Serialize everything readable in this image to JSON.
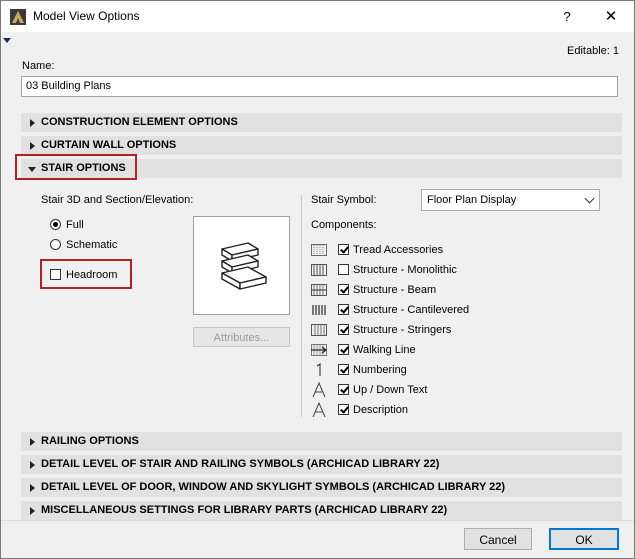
{
  "window": {
    "title": "Model View Options",
    "help_label": "?",
    "close_label": "✕",
    "editable_text": "Editable: 1"
  },
  "name_field": {
    "label": "Name:",
    "value": "03 Building Plans"
  },
  "sections": {
    "construction": "CONSTRUCTION ELEMENT OPTIONS",
    "curtain_wall": "CURTAIN WALL OPTIONS",
    "stair": "STAIR OPTIONS",
    "railing": "RAILING OPTIONS",
    "detail_stair": "DETAIL LEVEL OF STAIR AND RAILING SYMBOLS (ARCHICAD LIBRARY 22)",
    "detail_door": "DETAIL LEVEL OF DOOR, WINDOW AND SKYLIGHT SYMBOLS (ARCHICAD LIBRARY 22)",
    "misc": "MISCELLANEOUS SETTINGS FOR LIBRARY PARTS (ARCHICAD LIBRARY 22)"
  },
  "stair_3d": {
    "label": "Stair 3D and Section/Elevation:",
    "full": "Full",
    "full_selected": true,
    "schematic": "Schematic",
    "headroom": "Headroom",
    "headroom_checked": false,
    "attributes_button": "Attributes..."
  },
  "stair_symbol": {
    "label": "Stair Symbol:",
    "selected": "Floor Plan Display"
  },
  "components": {
    "label": "Components:",
    "items": [
      {
        "label": "Tread Accessories",
        "checked": true,
        "icon": "tread-accessories-icon"
      },
      {
        "label": "Structure - Monolithic",
        "checked": false,
        "icon": "structure-monolithic-icon"
      },
      {
        "label": "Structure - Beam",
        "checked": true,
        "icon": "structure-beam-icon"
      },
      {
        "label": "Structure - Cantilevered",
        "checked": true,
        "icon": "structure-cantilevered-icon"
      },
      {
        "label": "Structure - Stringers",
        "checked": true,
        "icon": "structure-stringers-icon"
      },
      {
        "label": "Walking Line",
        "checked": true,
        "icon": "walking-line-icon"
      },
      {
        "label": "Numbering",
        "checked": true,
        "icon": "numbering-icon"
      },
      {
        "label": "Up / Down Text",
        "checked": true,
        "icon": "text-a-icon"
      },
      {
        "label": "Description",
        "checked": true,
        "icon": "text-a-icon"
      }
    ]
  },
  "footer": {
    "cancel": "Cancel",
    "ok": "OK"
  }
}
